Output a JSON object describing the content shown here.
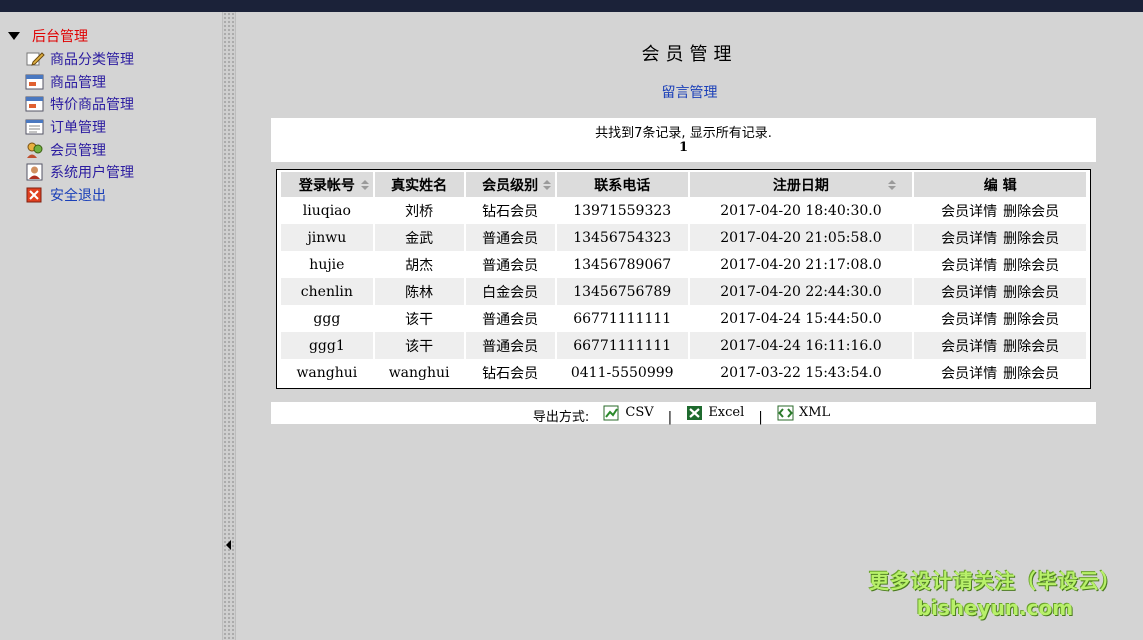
{
  "sidebar": {
    "root_label": "后台管理",
    "items": [
      {
        "label": "商品分类管理",
        "icon": "edit-pencil-icon"
      },
      {
        "label": "商品管理",
        "icon": "window-icon"
      },
      {
        "label": "特价商品管理",
        "icon": "window-icon"
      },
      {
        "label": "订单管理",
        "icon": "list-window-icon"
      },
      {
        "label": "会员管理",
        "icon": "users-icon"
      },
      {
        "label": "系统用户管理",
        "icon": "user-icon"
      },
      {
        "label": "安全退出",
        "icon": "close-icon"
      }
    ]
  },
  "main": {
    "title": "会员管理",
    "message_link": "留言管理",
    "summary": "共找到7条记录, 显示所有记录.",
    "page_number": "1"
  },
  "table": {
    "headers": [
      "登录帐号",
      "真实姓名",
      "会员级别",
      "联系电话",
      "注册日期",
      "编 辑"
    ],
    "rows": [
      [
        "liuqiao",
        "刘桥",
        "钻石会员",
        "13971559323",
        "2017-04-20 18:40:30.0"
      ],
      [
        "jinwu",
        "金武",
        "普通会员",
        "13456754323",
        "2017-04-20 21:05:58.0"
      ],
      [
        "hujie",
        "胡杰",
        "普通会员",
        "13456789067",
        "2017-04-20 21:17:08.0"
      ],
      [
        "chenlin",
        "陈林",
        "白金会员",
        "13456756789",
        "2017-04-20 22:44:30.0"
      ],
      [
        "ggg",
        "该干",
        "普通会员",
        "66771111111",
        "2017-04-24 15:44:50.0"
      ],
      [
        "ggg1",
        "该干",
        "普通会员",
        "66771111111",
        "2017-04-24 16:11:16.0"
      ],
      [
        "wanghui",
        "wanghui",
        "钻石会员",
        "0411-5550999",
        "2017-03-22 15:43:54.0"
      ]
    ],
    "detail_label": "会员详情",
    "delete_label": "删除会员"
  },
  "export": {
    "label": "导出方式:",
    "csv": "CSV",
    "excel": "Excel",
    "xml": "XML",
    "separator": "|"
  },
  "watermark": {
    "line1": "更多设计请关注（毕设云）",
    "line2": "bisheyun.com"
  },
  "colors": {
    "topbar": "#1b2239",
    "background": "#d4d4d4",
    "root_label": "#e00000",
    "menu_text": "#2b1ca0",
    "link": "#1a3fb8"
  }
}
